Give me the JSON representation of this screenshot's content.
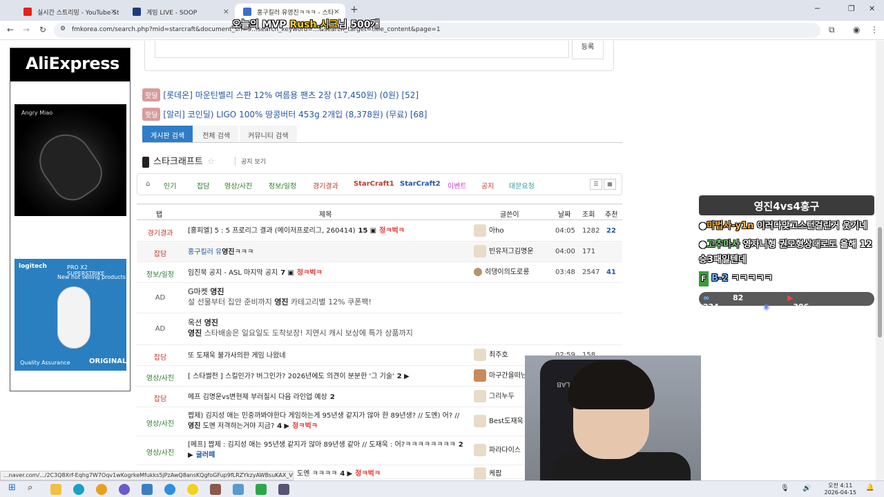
{
  "browser": {
    "tabs": [
      {
        "label": "실시간 스트리밍 - YouTube St",
        "color": "#e62117"
      },
      {
        "label": "게임 LIVE - SOOP",
        "color": "#1c3c7a"
      },
      {
        "label": "홍구킬러 유영진ㅋㅋㅋ - 스타",
        "color": "#3d6fc4"
      }
    ],
    "new_tab": "+",
    "url": "fmkorea.com/search.php?mid=starcraft&document_srl=9…search_keyword=…&search_target=title_content&page=1",
    "status_url": "...naver.com/.../2C3Q8Xrf-Eqhg7W7Oqv1wKogrkeMfukks5jPzAwQ8ansKQgfoGFup9fLRZYkzyAWBsuKAX_VO9vQRg..."
  },
  "overlay_caption": {
    "pre": "오늘의 MVP ",
    "name": "Rush.시크",
    "post": "님 500개"
  },
  "left_ad": {
    "brand": "AliExpress",
    "mouse_brand": "Angry Miao",
    "logi_brand": "logitech",
    "logi_product": "PRO X2 SUPERSTRIKE",
    "logi_tagline": "New hot selling products",
    "logi_quality": "Quality Assurance",
    "logi_original": "ORIGINAL"
  },
  "register_button": "등록",
  "hot_deals": [
    {
      "badge": "핫딜",
      "text": "[롯데온] 마운틴벨리 스판 12% 여름용 팬츠 2장 (17,450원) (0원) [52]"
    },
    {
      "badge": "핫딜",
      "text": "[알리] 코인딜) LIGO 100% 땅콩버터 453g 2개입 (8,378원) (무료) [68]"
    }
  ],
  "search_tabs": [
    "게시판 검색",
    "전체 검색",
    "커뮤니티 검색"
  ],
  "board": {
    "title": "스타크래프트",
    "notice_view": "공지 보기"
  },
  "categories": [
    {
      "label": "인기",
      "color": "#2a7a2a"
    },
    {
      "label": "잡담",
      "color": "#2a7a2a"
    },
    {
      "label": "영상/사진",
      "color": "#2a7a2a"
    },
    {
      "label": "정보/일정",
      "color": "#2a7a2a"
    },
    {
      "label": "경기결과",
      "color": "#c0392b"
    },
    {
      "label": "StarCraft1",
      "color": "#c0392b"
    },
    {
      "label": "StarCraft2",
      "color": "#2256a8"
    },
    {
      "label": "이벤트",
      "color": "#d63ed6"
    },
    {
      "label": "공지",
      "color": "#c0392b"
    },
    {
      "label": "대문요청",
      "color": "#2a9a9a"
    }
  ],
  "table_header": {
    "tab": "탭",
    "title": "제목",
    "author": "글쓴이",
    "date": "날짜",
    "views": "조회",
    "rec": "추천"
  },
  "rows": [
    {
      "cat": "경기결과",
      "title": "[홍피엘] 5 : 5 프로리그 결과 (메이저프로리그, 260414)",
      "cnt": "15",
      "cmt": "정ㅋ벅ㅋ",
      "author": "아ho",
      "time": "04:05",
      "views": "1282",
      "rec": "22"
    },
    {
      "cat": "잡담",
      "title_pre": "홍구킬러 유",
      "title_bold": "영진",
      "title_post": "ㅋㅋㅋ",
      "author": "빈유저그김명운",
      "time": "04:00",
      "views": "171",
      "rec": ""
    },
    {
      "cat": "정보/일정",
      "title": "임진묵 공지 - ASL 마지막 공지",
      "cnt": "7",
      "cmt": "정ㅋ벅ㅋ",
      "author": "히댕이의도로롱",
      "time": "03:48",
      "views": "2547",
      "rec": "41"
    },
    {
      "cat": "AD",
      "l1_pre": "G마켓 ",
      "l1_bold": "영진",
      "l2_pre": "설 선물부터 집안 준비까지 ",
      "l2_bold": "영진",
      "l2_post": " 카테고리별 12% 쿠폰팩!"
    },
    {
      "cat": "AD",
      "l1_pre": "옥션 ",
      "l1_bold": "영진",
      "l2_pre": "",
      "l2_bold": "영진",
      "l2_post": " 스타배송은 일요일도 도착보장! 지연시 캐시 보상에 특가 상품까지"
    },
    {
      "cat": "잡담",
      "title": "또 도재욱 불가사의한 게임 나왔네",
      "author": "최주호",
      "time": "02:59",
      "views": "158",
      "rec": ""
    },
    {
      "cat": "영상/사진",
      "title": "[ 스타썰전 ] 스킬인가? 버그인가? 2026년에도 의견이 분분한 '그 기술'",
      "cnt": "2",
      "author": "마구간을떠난말",
      "time": "",
      "views": "",
      "rec": ""
    },
    {
      "cat": "잡담",
      "title": "메프 김명운vs변현제 부러질시 다음 라인업 예상",
      "cnt": "2",
      "author": "그리누두",
      "time": "",
      "views": "",
      "rec": ""
    },
    {
      "cat": "영상/사진",
      "title_pre": "짭제) 김지성 애는 민중까봐야한다 게임하는게 95년생 같지가 않아 한 89년생? // 도멘) 어? // ",
      "title_bold": "영진",
      "title_post": " 도멘 저격하는거야 지금?",
      "cnt": "4",
      "cmt": "정ㅋ벅ㅋ",
      "author": "Best도재욱",
      "time": "",
      "views": "",
      "rec": ""
    },
    {
      "cat": "영상/사진",
      "title": "[메프] 짭제 : 김지성 애는 95년생 같지가 않아 89년생 같아 // 도재욱 : 어?ㅋㅋㅋㅋㅋㅋㅋㅋ",
      "cnt": "2",
      "cmt": "굴러떼",
      "author": "파라다이스",
      "time": "",
      "views": "",
      "rec": ""
    },
    {
      "cat": "",
      "title": "도멘 ㅋㅋㅋㅋ",
      "cnt": "4",
      "cmt": "정ㅋ벅ㅋ",
      "author": "케팝",
      "time": "",
      "views": "",
      "rec": ""
    }
  ],
  "chat": {
    "header": "영진4vs4홍구",
    "messages": [
      {
        "user": "마법사-y1n",
        "text": " 이러다맞고스턴걸린거 웃기네"
      },
      {
        "user": "고추마사",
        "text": " 영자니형 권모형상대로도 올해 12승3패일텐데"
      },
      {
        "user": "B-2",
        "text": " ㅋㅋㅋㅋㅋ"
      }
    ],
    "viewers": [
      {
        "platform": "soop",
        "count": "82"
      },
      {
        "platform": "youtube",
        "count": "224"
      },
      {
        "platform": "chzzk",
        "count": "306"
      }
    ]
  },
  "webcam": {
    "chair_brand": "SECRET LAB"
  },
  "taskbar": {
    "time": "오전 4:11",
    "date": "2026-04-15"
  }
}
